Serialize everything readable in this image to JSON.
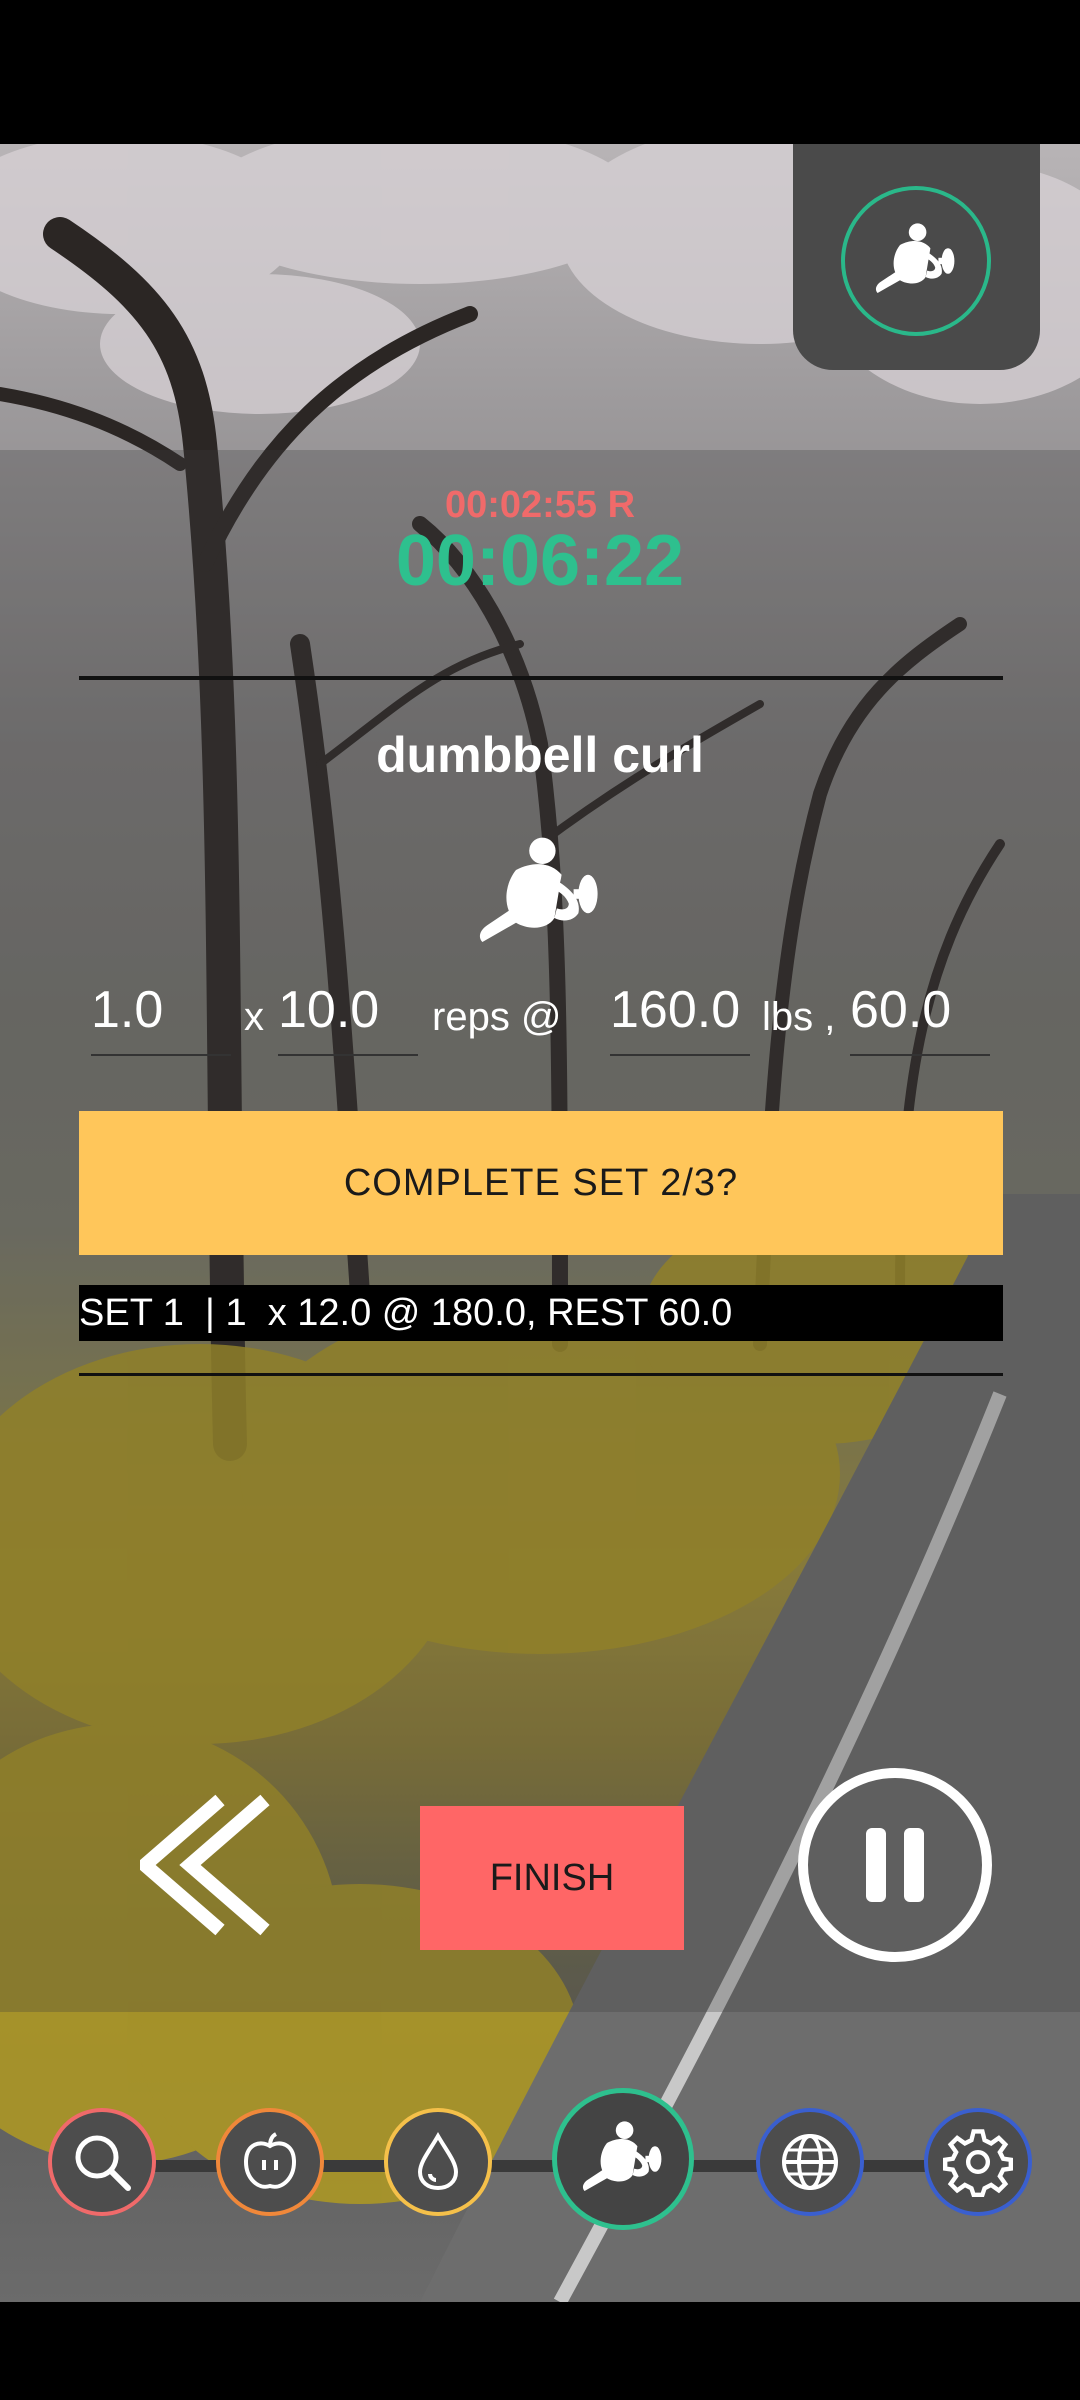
{
  "timer": {
    "rest": "00:02:55 R",
    "elapsed": "00:06:22"
  },
  "exercise": {
    "name": "dumbbell curl"
  },
  "inputs": {
    "sets": "1.0",
    "x_label": "x",
    "reps": "10.0",
    "reps_label": "reps @",
    "weight": "160.0",
    "unit_label": "lbs ,",
    "rest": "60.0"
  },
  "actions": {
    "complete_label": "COMPLETE SET 2/3?",
    "finish_label": "FINISH"
  },
  "history": [
    "SET 1  | 1  x 12.0 @ 180.0, REST 60.0"
  ],
  "nav": {
    "items": [
      {
        "name": "search",
        "color": "#f06a6a"
      },
      {
        "name": "nutrition",
        "color": "#f0883a"
      },
      {
        "name": "water",
        "color": "#f5c04a"
      },
      {
        "name": "workout",
        "color": "#2ec08e",
        "active": true
      },
      {
        "name": "web",
        "color": "#3a5fcf"
      },
      {
        "name": "settings",
        "color": "#3a5fcf"
      }
    ]
  },
  "colors": {
    "accent": "#2ec08e",
    "rest_timer": "#f06a6a",
    "complete": "#ffc65a",
    "finish": "#ff6666"
  }
}
